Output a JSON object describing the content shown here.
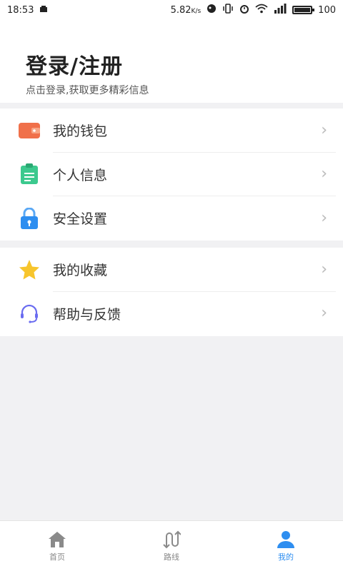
{
  "status_bar": {
    "time": "18:53",
    "net_speed": "5.82",
    "net_unit": "K/s",
    "battery_level": "100",
    "battery_percent": 100
  },
  "header": {
    "title": "登录/注册",
    "subtitle": "点击登录,获取更多精彩信息"
  },
  "menu_group_1": [
    {
      "label": "我的钱包",
      "icon": "wallet-icon",
      "color": "#f0704a"
    },
    {
      "label": "个人信息",
      "icon": "id-card-icon",
      "color": "#3cc98e"
    },
    {
      "label": "安全设置",
      "icon": "lock-icon",
      "color": "#2e8ef0"
    }
  ],
  "menu_group_2": [
    {
      "label": "我的收藏",
      "icon": "star-icon",
      "color": "#f7c52c"
    },
    {
      "label": "帮助与反馈",
      "icon": "headset-icon",
      "color": "#6a6cf0"
    }
  ],
  "chevron": "›",
  "bottom_nav": [
    {
      "label": "首页",
      "icon": "home-icon",
      "active": false
    },
    {
      "label": "路线",
      "icon": "route-icon",
      "active": false
    },
    {
      "label": "我的",
      "icon": "user-icon",
      "active": true
    }
  ],
  "colors": {
    "accent": "#2e8ef0",
    "inactive": "#888888",
    "background": "#f1f1f3"
  }
}
